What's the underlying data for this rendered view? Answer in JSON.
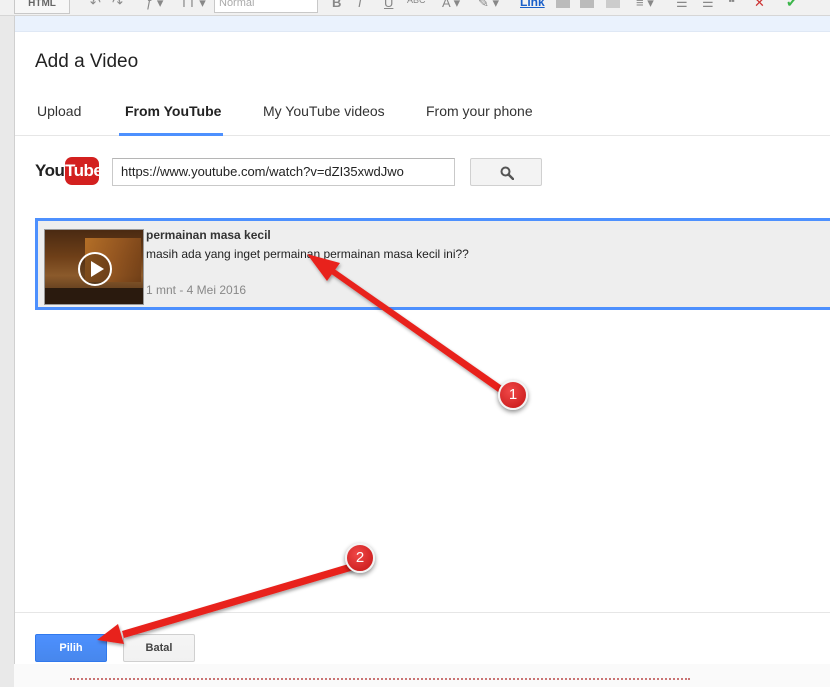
{
  "toolbar": {
    "html_label": "HTML",
    "font_size_value": "Normal",
    "link_label": "Link"
  },
  "dialog": {
    "title": "Add a Video",
    "tabs": [
      {
        "label": "Upload",
        "active": false
      },
      {
        "label": "From YouTube",
        "active": true
      },
      {
        "label": "My YouTube videos",
        "active": false
      },
      {
        "label": "From your phone",
        "active": false
      }
    ],
    "youtube_logo": {
      "you": "You",
      "tube": "Tube"
    },
    "search": {
      "value": "https://www.youtube.com/watch?v=dZI35xwdJwo",
      "button_icon": "search-icon"
    },
    "result": {
      "title": "permainan masa kecil",
      "description": "masih ada yang inget permainan permainan masa kecil ini??",
      "meta": "1 mnt - 4 Mei 2016",
      "selected": true
    },
    "footer": {
      "select_label": "Pilih",
      "cancel_label": "Batal"
    }
  },
  "annotations": {
    "badge_1": "1",
    "badge_2": "2",
    "color": "#e8211d"
  },
  "colors": {
    "accent": "#4d90fe",
    "youtube_red": "#d3201f",
    "selected_bg": "#eeeeee"
  }
}
